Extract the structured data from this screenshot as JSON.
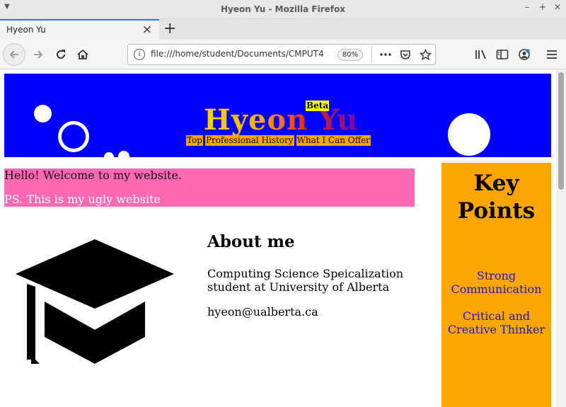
{
  "window": {
    "title": "Hyeon Yu - Mozilla Firefox"
  },
  "tabs": [
    {
      "label": "Hyeon Yu"
    }
  ],
  "urlbar": {
    "url": "file:///home/student/Documents/CMPUT4",
    "zoom": "80%"
  },
  "icons": {
    "back": "arrow-left-icon",
    "forward": "arrow-right-icon",
    "reload": "reload-icon",
    "home": "home-icon",
    "info": "info-icon",
    "more": "ellipsis-icon",
    "pocket": "pocket-icon",
    "bookmark": "star-icon",
    "library": "library-icon",
    "sidebar": "sidebar-icon",
    "account": "account-icon",
    "menu": "hamburger-icon",
    "graduation": "graduation-cap-icon"
  },
  "site": {
    "name": "Hyeon Yu",
    "badge": "Beta",
    "nav": [
      "Top",
      "Professional History",
      "What I Can Offer"
    ]
  },
  "welcome": {
    "greeting": "Hello! Welcome to my website.",
    "note": "PS. This is my ugly website"
  },
  "about": {
    "title": "About me",
    "description": "Computing Science Speicalization student at University of Alberta",
    "email": "hyeon@ualberta.ca"
  },
  "key_points": {
    "title": "Key Points",
    "items": [
      "Strong Communication",
      "Critical and Creative Thinker"
    ]
  },
  "colors": {
    "banner": "#0000ff",
    "nav_link": "#ffa500",
    "beta": "#ffff00",
    "welcome_box": "#ff69b4",
    "key_box": "#ffa500",
    "key_point_text": "#1a1aa8"
  }
}
